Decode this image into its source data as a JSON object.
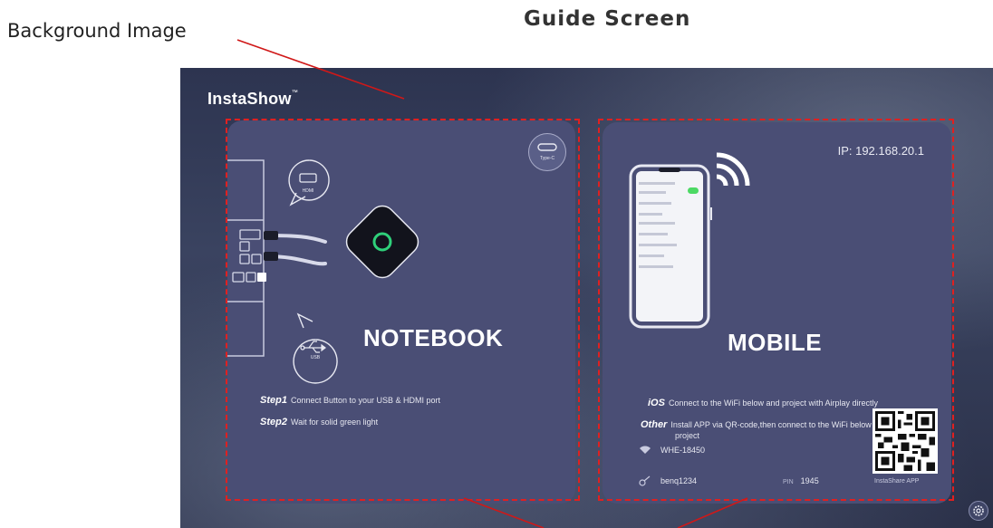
{
  "annotations": {
    "background_label": "Background Image",
    "title": "Guide Screen"
  },
  "screen": {
    "brand": "InstaShow",
    "brand_mark": "™",
    "notebook": {
      "label": "NOTEBOOK",
      "type_c_label": "Type-C",
      "hdmi_label": "HDMI",
      "usb_label": "USB",
      "step1_title": "Step1",
      "step1_text": "Connect Button to your USB & HDMI port",
      "step2_title": "Step2",
      "step2_text": "Wait for solid green light"
    },
    "mobile": {
      "label": "MOBILE",
      "ip": "IP: 192.168.20.1",
      "ios_title": "iOS",
      "ios_text": "Connect to the WiFi below and project with Airplay directly",
      "other_title": "Other",
      "other_text_line1": "Install APP via QR-code,then connect to the WiFi below to",
      "other_text_line2": "project",
      "wifi_name": "WHE-18450",
      "password": "benq1234",
      "pin_label": "PIN",
      "pin": "1945",
      "qr_caption": "InstaShare APP"
    }
  },
  "colors": {
    "card": "#4a4e75",
    "led": "#2fd07a",
    "annotation": "#e02020"
  }
}
